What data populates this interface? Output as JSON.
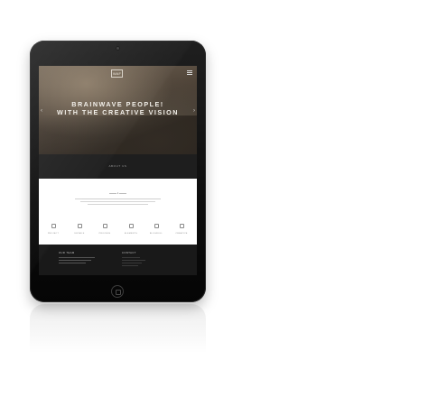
{
  "hero": {
    "logo": "WAF",
    "title_line1": "BRAINWAVE PEOPLE!",
    "title_line2": "WITH THE CREATIVE VISION",
    "prev_arrow": "‹",
    "next_arrow": "›"
  },
  "about": {
    "label": "ABOUT US"
  },
  "divider": {
    "glyph": "♦"
  },
  "features": [
    {
      "label": "PROJECT",
      "icon": "pin-icon"
    },
    {
      "label": "DETAILS",
      "icon": "rocket-icon"
    },
    {
      "label": "PROCESS",
      "icon": "diamond-icon"
    },
    {
      "label": "ELEMENTS",
      "icon": "device-icon"
    },
    {
      "label": "BLOGROLL",
      "icon": "monitor-icon"
    },
    {
      "label": "CREATIVE",
      "icon": "tools-icon"
    }
  ],
  "footer": {
    "team_heading": "OUR TEAM",
    "contact_heading": "CONTACT"
  },
  "colors": {
    "device_body": "#0d0d0d",
    "hero_text": "#f2efe9",
    "dark_band": "#1e1e1e",
    "footer_bg": "#191919"
  }
}
